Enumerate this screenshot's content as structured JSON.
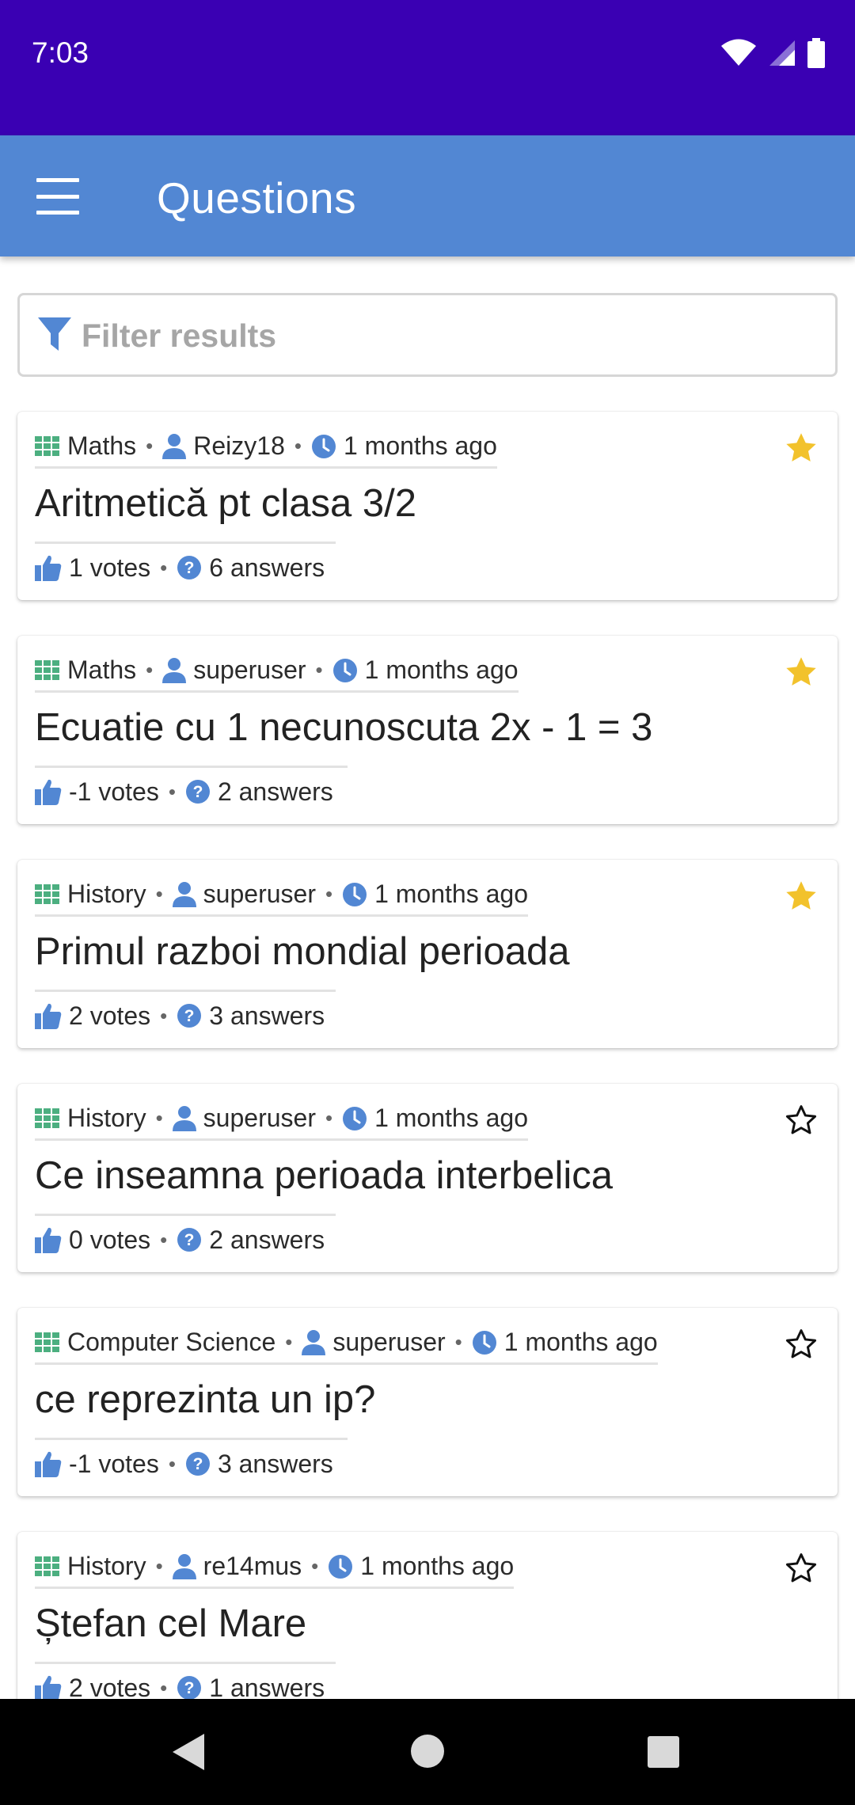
{
  "status_bar": {
    "time": "7:03"
  },
  "app_bar": {
    "title": "Questions"
  },
  "filter": {
    "placeholder": "Filter results",
    "value": ""
  },
  "colors": {
    "status_bar": "#3a00b3",
    "app_bar": "#5287d3",
    "accent_icon": "#5287d3",
    "category_icon": "#4caf80",
    "star_filled": "#f2c22c"
  },
  "questions": [
    {
      "category": "Maths",
      "author": "Reizy18",
      "time": "1 months ago",
      "title": "Aritmetică pt clasa 3/2",
      "votes": "1 votes",
      "answers": "6 answers",
      "starred": true
    },
    {
      "category": "Maths",
      "author": "superuser",
      "time": "1 months ago",
      "title": "Ecuatie cu 1 necunoscuta 2x - 1 = 3",
      "votes": "-1 votes",
      "answers": "2 answers",
      "starred": true
    },
    {
      "category": "History",
      "author": "superuser",
      "time": "1 months ago",
      "title": "Primul razboi mondial perioada",
      "votes": "2 votes",
      "answers": "3 answers",
      "starred": true
    },
    {
      "category": "History",
      "author": "superuser",
      "time": "1 months ago",
      "title": "Ce inseamna perioada interbelica",
      "votes": "0 votes",
      "answers": "2 answers",
      "starred": false
    },
    {
      "category": "Computer Science",
      "author": "superuser",
      "time": "1 months ago",
      "title": "ce reprezinta un ip?",
      "votes": "-1 votes",
      "answers": "3 answers",
      "starred": false
    },
    {
      "category": "History",
      "author": "re14mus",
      "time": "1 months ago",
      "title": "Ștefan cel Mare",
      "votes": "2 votes",
      "answers": "1 answers",
      "starred": false
    }
  ],
  "icons": {
    "menu": "menu-icon",
    "filter": "filter-icon",
    "category": "grid-icon",
    "author": "user-icon",
    "time": "clock-icon",
    "votes": "thumbs-up-icon",
    "answers": "question-circle-icon",
    "favorite": "star-icon",
    "nav_back": "back-triangle-icon",
    "nav_home": "home-circle-icon",
    "nav_recents": "recents-square-icon"
  }
}
